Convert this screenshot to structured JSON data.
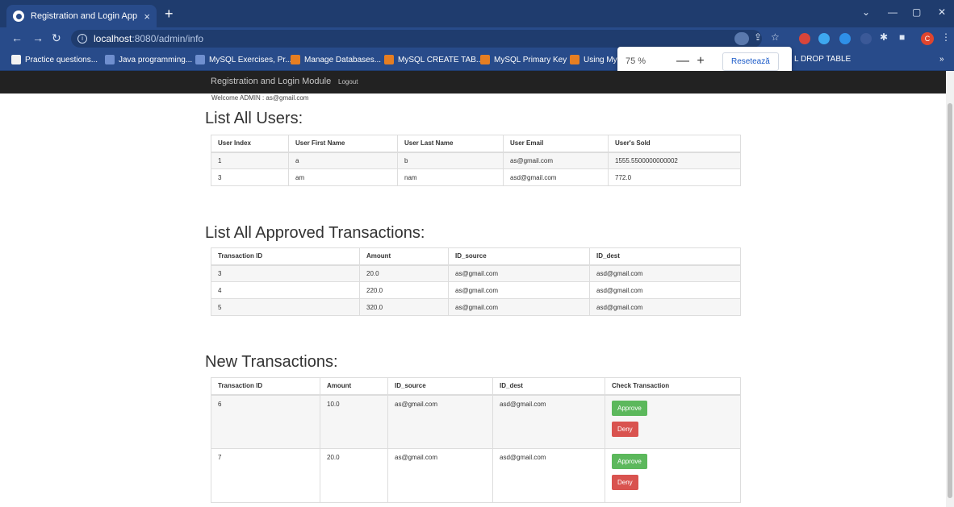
{
  "browser": {
    "tab_title": "Registration and Login App",
    "tab_close": "×",
    "new_tab": "+",
    "url_host": "localhost",
    "url_path": ":8080/admin/info",
    "profile_initial": "C",
    "bookmarks": [
      {
        "label": "Practice questions...",
        "color": "#f2f2f2"
      },
      {
        "label": "Java programming...",
        "color": "#6f8fcf"
      },
      {
        "label": "MySQL Exercises, Pr...",
        "color": "#6f8fcf"
      },
      {
        "label": "Manage Databases...",
        "color": "#e67e22"
      },
      {
        "label": "MySQL CREATE TAB...",
        "color": "#e67e22"
      },
      {
        "label": "MySQL Primary Key",
        "color": "#e67e22"
      },
      {
        "label": "Using MyS",
        "color": "#e67e22"
      },
      {
        "label": "L DROP TABLE",
        "color": "#e67e22"
      }
    ],
    "bookmarks_more": "»",
    "zoom": {
      "value": "75 %",
      "minus": "—",
      "plus": "+",
      "reset_label": "Resetează"
    }
  },
  "navbar": {
    "brand": "Registration and Login Module",
    "logout": "Logout"
  },
  "welcome": "Welcome ADMIN : as@gmail.com",
  "users": {
    "title": "List All Users:",
    "headers": [
      "User Index",
      "User First Name",
      "User Last Name",
      "User Email",
      "User's Sold"
    ],
    "rows": [
      [
        "1",
        "a",
        "b",
        "as@gmail.com",
        "1555.5500000000002"
      ],
      [
        "3",
        "am",
        "nam",
        "asd@gmail.com",
        "772.0"
      ]
    ]
  },
  "approved": {
    "title": "List All Approved Transactions:",
    "headers": [
      "Transaction ID",
      "Amount",
      "ID_source",
      "ID_dest"
    ],
    "rows": [
      [
        "3",
        "20.0",
        "as@gmail.com",
        "asd@gmail.com"
      ],
      [
        "4",
        "220.0",
        "as@gmail.com",
        "asd@gmail.com"
      ],
      [
        "5",
        "320.0",
        "as@gmail.com",
        "asd@gmail.com"
      ]
    ]
  },
  "new_tx": {
    "title": "New Transactions:",
    "headers": [
      "Transaction ID",
      "Amount",
      "ID_source",
      "ID_dest",
      "Check Transaction"
    ],
    "approve_label": "Approve",
    "deny_label": "Deny",
    "rows": [
      [
        "6",
        "10.0",
        "as@gmail.com",
        "asd@gmail.com"
      ],
      [
        "7",
        "20.0",
        "as@gmail.com",
        "asd@gmail.com"
      ]
    ]
  },
  "colors": {
    "approve": "#5cb85c",
    "deny": "#d9534f",
    "navbar": "#222222",
    "chrome": "#284b8a"
  }
}
